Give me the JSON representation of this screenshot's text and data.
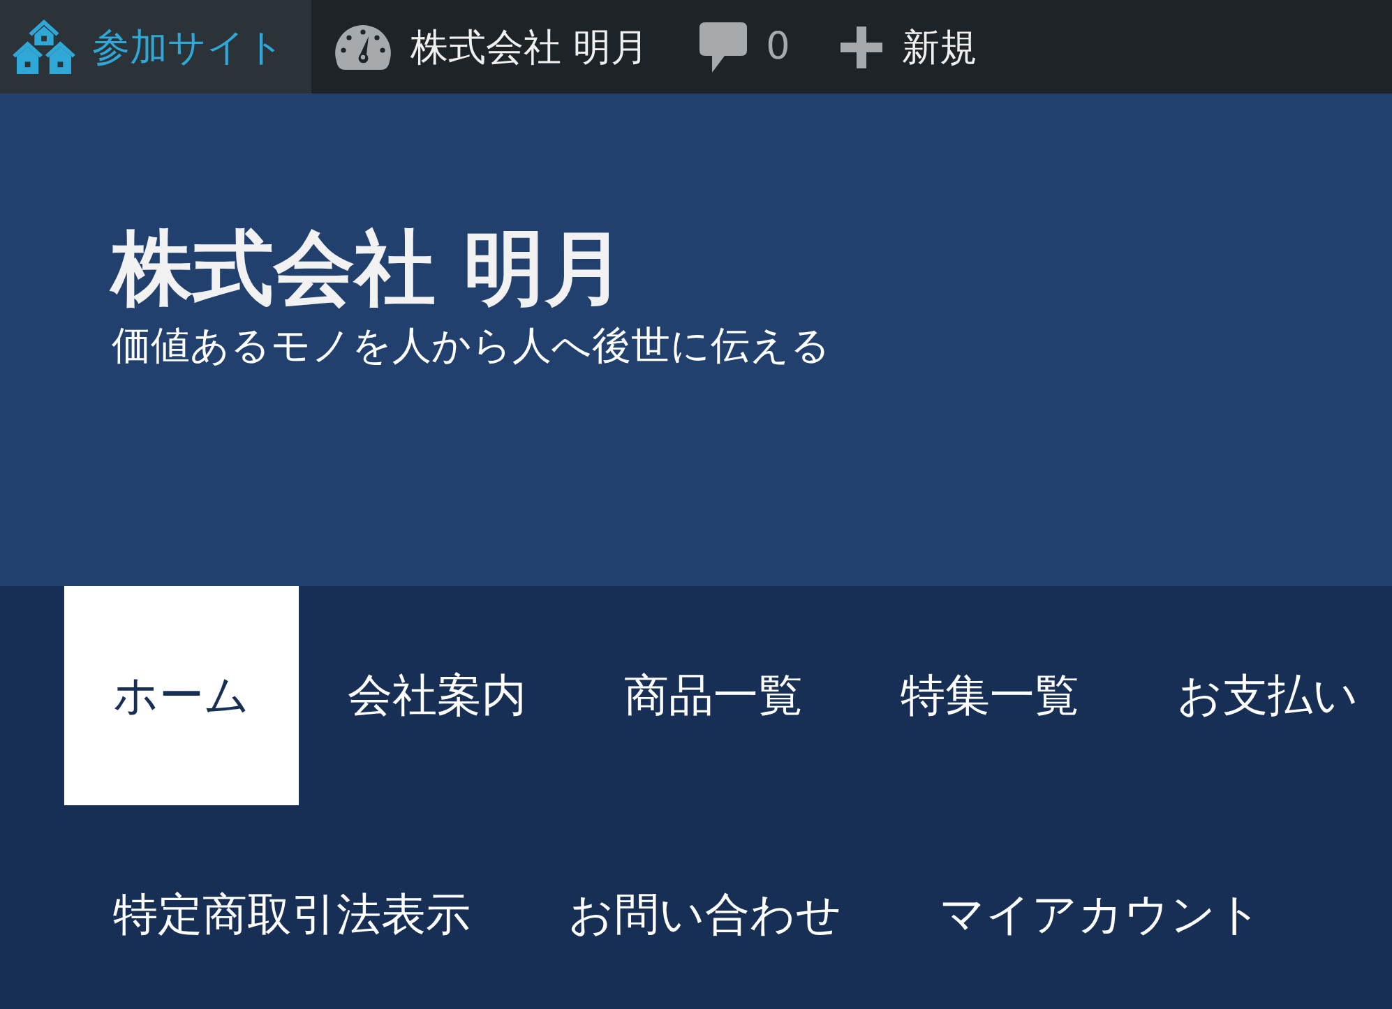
{
  "admin_bar": {
    "items": [
      {
        "kind": "my-sites",
        "label": "参加サイト",
        "selected": true
      },
      {
        "kind": "site",
        "label": "株式会社 明月",
        "selected": false
      },
      {
        "kind": "comments",
        "label": "0",
        "selected": false
      },
      {
        "kind": "new",
        "label": "新規",
        "selected": false
      }
    ]
  },
  "header": {
    "site_title": "株式会社 明月",
    "tagline": "価値あるモノを人から人へ後世に伝える"
  },
  "menu": {
    "items": [
      {
        "label": "ホーム",
        "selected": true
      },
      {
        "label": "会社案内",
        "selected": false
      },
      {
        "label": "商品一覧",
        "selected": false
      },
      {
        "label": "特集一覧",
        "selected": false
      },
      {
        "label": "お支払い",
        "selected": false
      },
      {
        "label": "特定商取引法表示",
        "selected": false
      },
      {
        "label": "お問い合わせ",
        "selected": false
      },
      {
        "label": "マイアカウント",
        "selected": false
      }
    ]
  }
}
